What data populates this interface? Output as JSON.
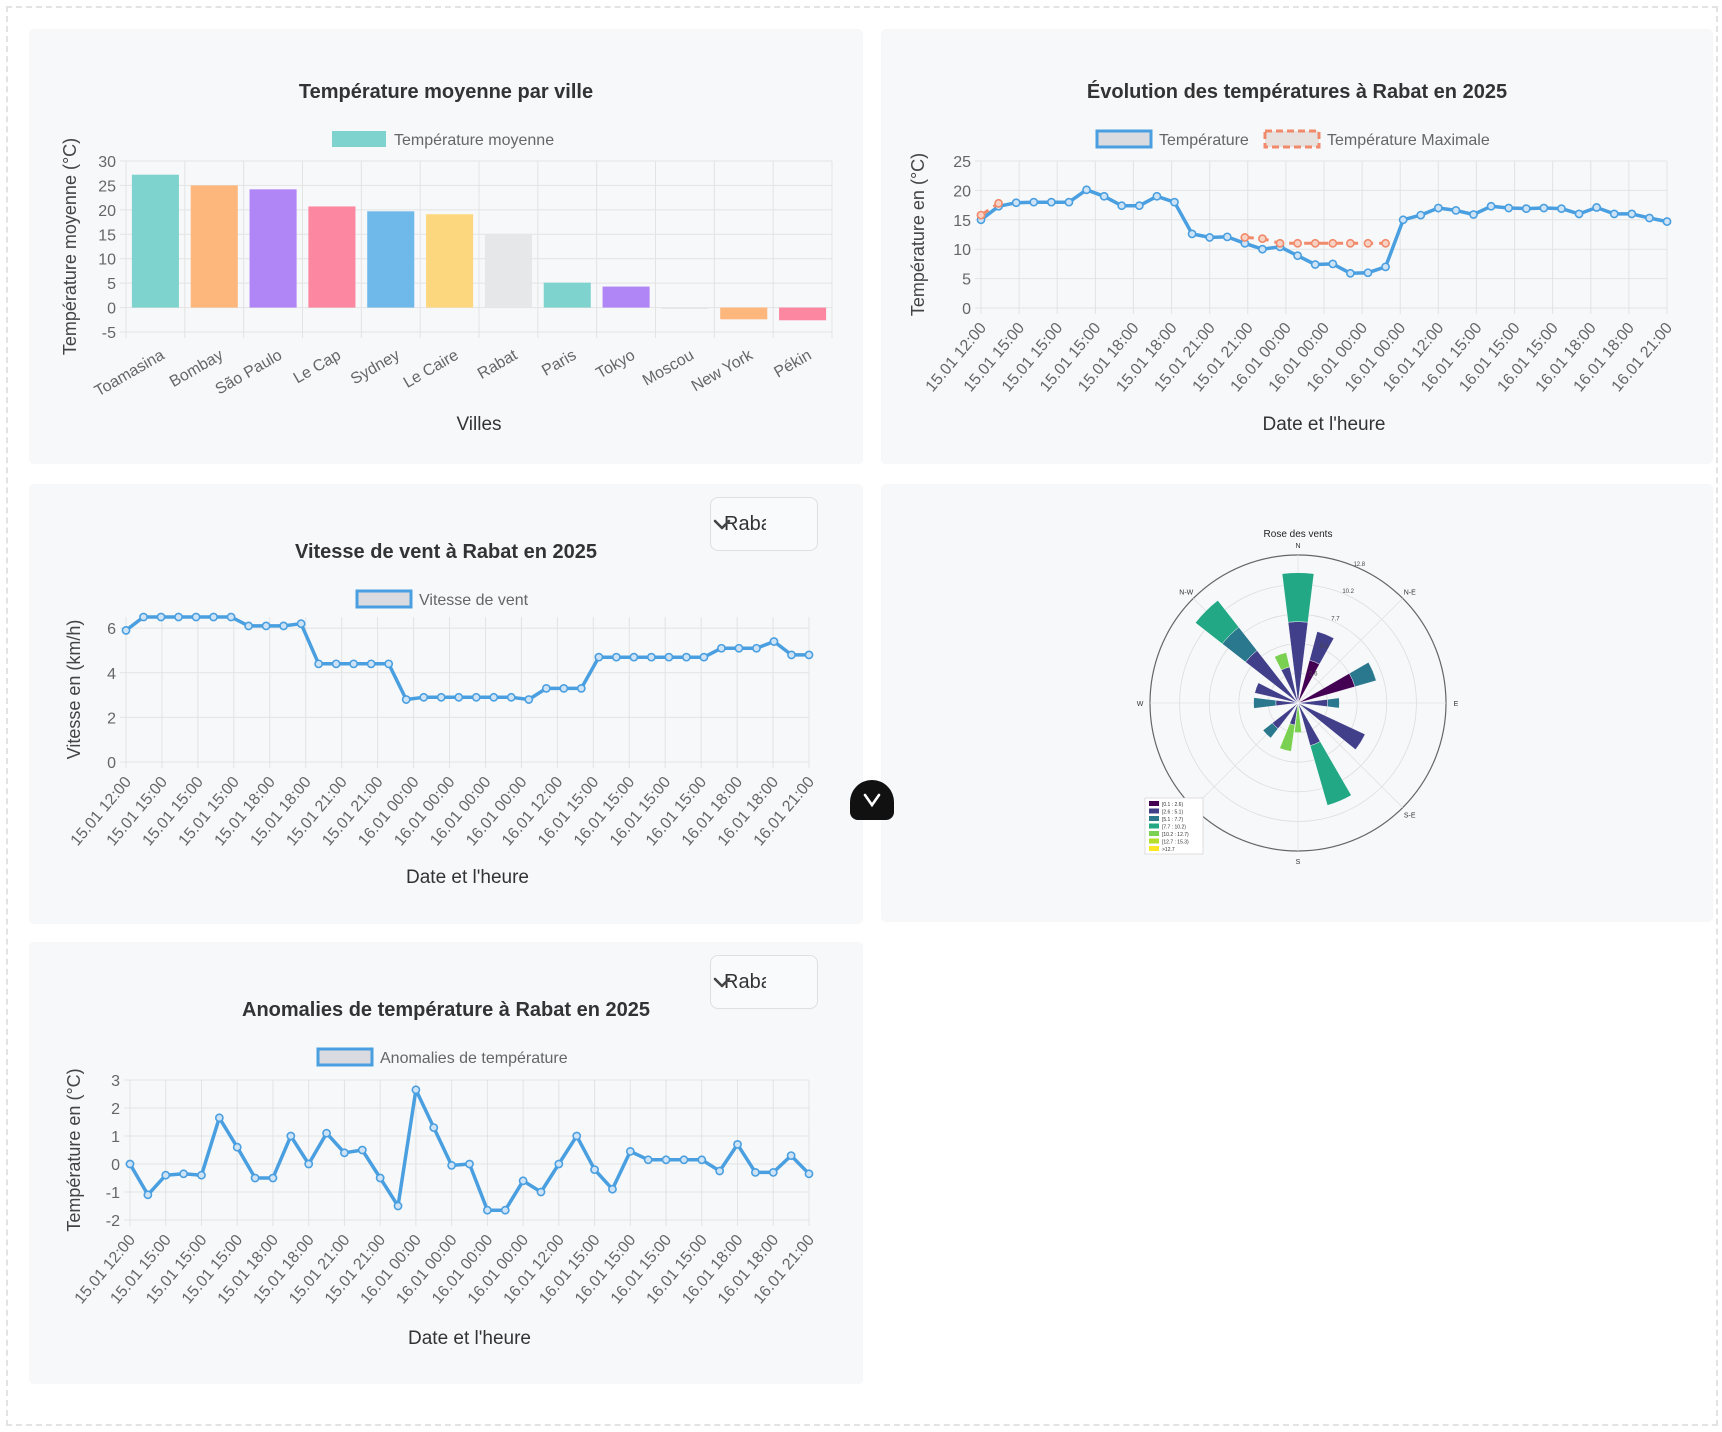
{
  "city_selector": {
    "wind": "Rabat",
    "anomaly": "Rabat"
  },
  "chart_data": [
    {
      "id": "avg_temp",
      "type": "bar",
      "title": "Température moyenne par ville",
      "xlabel": "Villes",
      "ylabel": "Température moyenne (°C)",
      "ylim": [
        -5,
        30
      ],
      "yticks": [
        -5,
        0,
        5,
        10,
        15,
        20,
        25,
        30
      ],
      "legend": "Température moyenne",
      "categories": [
        "Toamasina",
        "Bombay",
        "São Paulo",
        "Le Cap",
        "Sydney",
        "Le Caire",
        "Rabat",
        "Paris",
        "Tokyo",
        "Moscou",
        "New York",
        "Pékin"
      ],
      "values": [
        27.2,
        25.0,
        24.2,
        20.7,
        19.7,
        19.1,
        15.0,
        5.1,
        4.3,
        -0.3,
        -2.4,
        -2.6
      ],
      "colors": [
        "#7fd3cf",
        "#fdb67b",
        "#b085f5",
        "#fb87a1",
        "#6fb9ea",
        "#fdd77d",
        "#e6e7e9",
        "#7fd3cf",
        "#b085f5",
        "#e6e7e9",
        "#fdb67b",
        "#fb87a1"
      ]
    },
    {
      "id": "temp_evolution",
      "type": "line",
      "title": "Évolution des températures à Rabat en 2025",
      "xlabel": "Date et l'heure",
      "ylabel": "Température en (°C)",
      "ylim": [
        0,
        25
      ],
      "yticks": [
        0,
        5,
        10,
        15,
        20,
        25
      ],
      "x": [
        "15.01 12:00",
        "15.01 15:00",
        "15.01 15:00",
        "15.01 15:00",
        "15.01 18:00",
        "15.01 18:00",
        "15.01 21:00",
        "15.01 21:00",
        "16.01 00:00",
        "16.01 00:00",
        "16.01 00:00",
        "16.01 00:00",
        "16.01 12:00",
        "16.01 15:00",
        "16.01 15:00",
        "16.01 15:00",
        "16.01 18:00",
        "16.01 18:00",
        "16.01 21:00"
      ],
      "series": [
        {
          "name": "Température",
          "color": "#4a9fe0",
          "values": [
            15,
            17.3,
            17.9,
            18,
            18,
            18,
            20.1,
            19,
            17.4,
            17.4,
            19,
            18,
            12.6,
            12,
            12.1,
            11,
            10,
            10.4,
            8.9,
            7.4,
            7.5,
            5.9,
            6,
            7,
            15,
            15.8,
            17,
            16.6,
            15.9,
            17.3,
            17,
            16.9,
            17,
            16.9,
            16,
            17.1,
            16,
            16,
            15.3,
            14.7
          ]
        },
        {
          "name": "Température Maximale",
          "color": "#f08a6a",
          "values": [
            15.8,
            17.8,
            null,
            null,
            null,
            null,
            null,
            null,
            null,
            null,
            null,
            null,
            null,
            null,
            null,
            12,
            11.8,
            11,
            11,
            11,
            11,
            11,
            11,
            11,
            null,
            null,
            null,
            null,
            null,
            null,
            null,
            null,
            null,
            null,
            null,
            null,
            null,
            null,
            null,
            null
          ]
        }
      ]
    },
    {
      "id": "wind_speed",
      "type": "line",
      "title": "Vitesse de vent à Rabat en 2025",
      "xlabel": "Date et l'heure",
      "ylabel": "Vitesse en (km/h)",
      "ylim": [
        0,
        6.5
      ],
      "yticks": [
        0,
        2,
        4,
        6
      ],
      "x": [
        "15.01 12:00",
        "15.01 15:00",
        "15.01 15:00",
        "15.01 15:00",
        "15.01 18:00",
        "15.01 18:00",
        "15.01 21:00",
        "15.01 21:00",
        "16.01 00:00",
        "16.01 00:00",
        "16.01 00:00",
        "16.01 00:00",
        "16.01 12:00",
        "16.01 15:00",
        "16.01 15:00",
        "16.01 15:00",
        "16.01 15:00",
        "16.01 18:00",
        "16.01 18:00",
        "16.01 21:00"
      ],
      "series": [
        {
          "name": "Vitesse de vent",
          "color": "#4a9fe0",
          "values": [
            5.9,
            6.5,
            6.5,
            6.5,
            6.5,
            6.5,
            6.5,
            6.1,
            6.1,
            6.1,
            6.2,
            4.4,
            4.4,
            4.4,
            4.4,
            4.4,
            2.8,
            2.9,
            2.9,
            2.9,
            2.9,
            2.9,
            2.9,
            2.8,
            3.3,
            3.3,
            3.3,
            4.7,
            4.7,
            4.7,
            4.7,
            4.7,
            4.7,
            4.7,
            5.1,
            5.1,
            5.1,
            5.4,
            4.8,
            4.8
          ]
        }
      ]
    },
    {
      "id": "anomaly",
      "type": "line",
      "title": "Anomalies de température à Rabat en 2025",
      "xlabel": "Date et l'heure",
      "ylabel": "Température en (°C)",
      "ylim": [
        -2,
        3
      ],
      "yticks": [
        -2,
        -1,
        0,
        1,
        2,
        3
      ],
      "x": [
        "15.01 12:00",
        "15.01 15:00",
        "15.01 15:00",
        "15.01 15:00",
        "15.01 18:00",
        "15.01 18:00",
        "15.01 21:00",
        "15.01 21:00",
        "16.01 00:00",
        "16.01 00:00",
        "16.01 00:00",
        "16.01 00:00",
        "16.01 12:00",
        "16.01 15:00",
        "16.01 15:00",
        "16.01 15:00",
        "16.01 15:00",
        "16.01 18:00",
        "16.01 18:00",
        "16.01 21:00"
      ],
      "series": [
        {
          "name": "Anomalies de température",
          "color": "#4a9fe0",
          "values": [
            0,
            -1.1,
            -0.4,
            -0.35,
            -0.4,
            1.65,
            0.6,
            -0.5,
            -0.5,
            1.0,
            0,
            1.1,
            0.4,
            0.5,
            -0.5,
            -1.5,
            2.65,
            1.3,
            -0.05,
            0,
            -1.65,
            -1.65,
            -0.6,
            -1.0,
            0,
            1.0,
            -0.2,
            -0.9,
            0.45,
            0.15,
            0.15,
            0.15,
            0.15,
            -0.25,
            0.7,
            -0.3,
            -0.3,
            0.3,
            -0.35
          ]
        }
      ]
    },
    {
      "id": "wind_rose",
      "type": "polar-bar",
      "title": "Rose des vents",
      "directions": [
        "N",
        "N-E",
        "E",
        "S-E",
        "S",
        "W",
        "N-W"
      ],
      "rings": [
        "2.6",
        "5.1",
        "7.7",
        "10.2",
        "12.8"
      ],
      "legend": [
        "[0.1 : 2.6)",
        "[2.6 : 5.1)",
        "[5.1 : 7.7)",
        "[7.7 : 10.2)",
        "[10.2 : 12.7)",
        "[12.7 : 15.3)",
        ">12.7"
      ],
      "colors": [
        "#440154",
        "#413f89",
        "#2a788e",
        "#22a884",
        "#7ad151",
        "#b5de2b",
        "#fde725"
      ]
    }
  ]
}
